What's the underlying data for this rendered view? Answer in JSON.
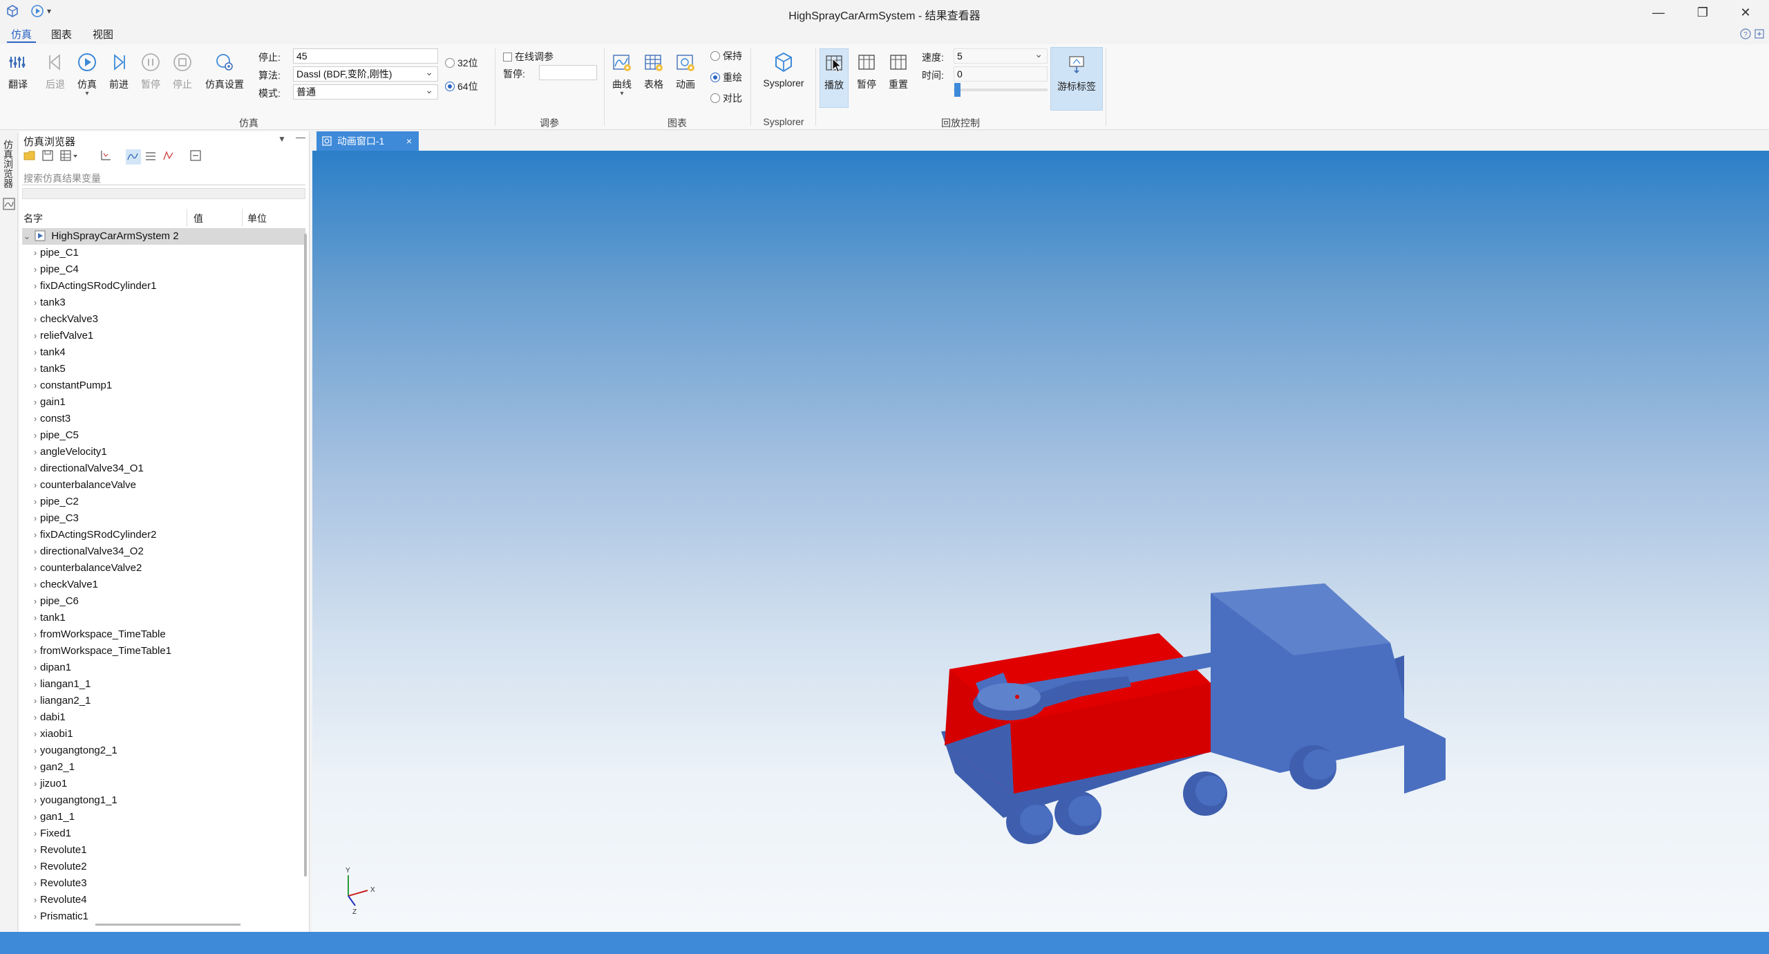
{
  "window": {
    "title": "HighSprayCarArmSystem - 结果查看器",
    "minimize_glyph": "—",
    "restore_glyph": "❐",
    "close_glyph": "✕",
    "quick_access": [
      "app-icon",
      "run-icon",
      "dropdown-icon"
    ]
  },
  "menu_tabs": [
    "仿真",
    "图表",
    "视图"
  ],
  "ribbon": {
    "sim_buttons": [
      {
        "label": "翻译",
        "icon": "translate-icon",
        "enabled": true
      },
      {
        "label": "后退",
        "icon": "back-icon",
        "enabled": false
      },
      {
        "label": "仿真",
        "icon": "simulate-icon",
        "enabled": true
      },
      {
        "label": "前进",
        "icon": "forward-icon",
        "enabled": true
      },
      {
        "label": "暂停",
        "icon": "pause-icon",
        "enabled": false
      },
      {
        "label": "停止",
        "icon": "stop-icon",
        "enabled": false
      },
      {
        "label": "仿真设置",
        "icon": "sim-settings-icon",
        "enabled": true
      }
    ],
    "stop_label": "停止:",
    "stop_value": "45",
    "algo_label": "算法:",
    "algo_value": "Dassl (BDF,变阶,刚性)",
    "mode_label": "模式:",
    "mode_value": "普通",
    "bit32": "32位",
    "bit64": "64位",
    "bit_selected": "64位",
    "group_sim": "仿真",
    "online_tune": "在线调参",
    "pause_label": "暂停:",
    "pause_value": "",
    "group_tune": "调参",
    "chart_buttons": [
      {
        "label": "曲线",
        "icon": "curve-icon"
      },
      {
        "label": "表格",
        "icon": "table-icon"
      },
      {
        "label": "动画",
        "icon": "animation-icon"
      }
    ],
    "radio_keep": "保持",
    "radio_redraw": "重绘",
    "radio_compare": "对比",
    "radio_selected": "重绘",
    "group_chart": "图表",
    "sysplorer_label": "Sysplorer",
    "group_sysplorer": "Sysplorer",
    "playback_buttons": [
      {
        "label": "播放",
        "icon": "play-icon",
        "active": true
      },
      {
        "label": "暂停",
        "icon": "pause-grid-icon",
        "active": false
      },
      {
        "label": "重置",
        "icon": "reset-icon",
        "active": false
      }
    ],
    "speed_label": "速度:",
    "speed_value": "5",
    "time_label": "时间:",
    "time_value": "0",
    "cursor_label": "游标标签",
    "group_playback": "回放控制"
  },
  "sidetab_label": "仿真浏览器",
  "browser": {
    "title": "仿真浏览器",
    "search_placeholder": "搜索仿真结果变量",
    "columns": [
      "名字",
      "值",
      "单位"
    ],
    "root": "HighSprayCarArmSystem 2",
    "items": [
      "pipe_C1",
      "pipe_C4",
      "fixDActingSRodCylinder1",
      "tank3",
      "checkValve3",
      "reliefValve1",
      "tank4",
      "tank5",
      "constantPump1",
      "gain1",
      "const3",
      "pipe_C5",
      "angleVelocity1",
      "directionalValve34_O1",
      "counterbalanceValve",
      "pipe_C2",
      "pipe_C3",
      "fixDActingSRodCylinder2",
      "directionalValve34_O2",
      "counterbalanceValve2",
      "checkValve1",
      "pipe_C6",
      "tank1",
      "fromWorkspace_TimeTable",
      "fromWorkspace_TimeTable1",
      "dipan1",
      "liangan1_1",
      "liangan2_1",
      "dabi1",
      "xiaobi1",
      "yougangtong2_1",
      "gan2_1",
      "jizuo1",
      "yougangtong1_1",
      "gan1_1",
      "Fixed1",
      "Revolute1",
      "Revolute2",
      "Revolute3",
      "Revolute4",
      "Prismatic1"
    ]
  },
  "doc_tab": {
    "label": "动画窗口-1",
    "close": "×"
  },
  "axes": {
    "x": "X",
    "y": "Y",
    "z": "Z"
  },
  "colors": {
    "accent": "#3e8ad9",
    "truck_body": "#4a6fc0",
    "tank_red": "#d40000"
  }
}
